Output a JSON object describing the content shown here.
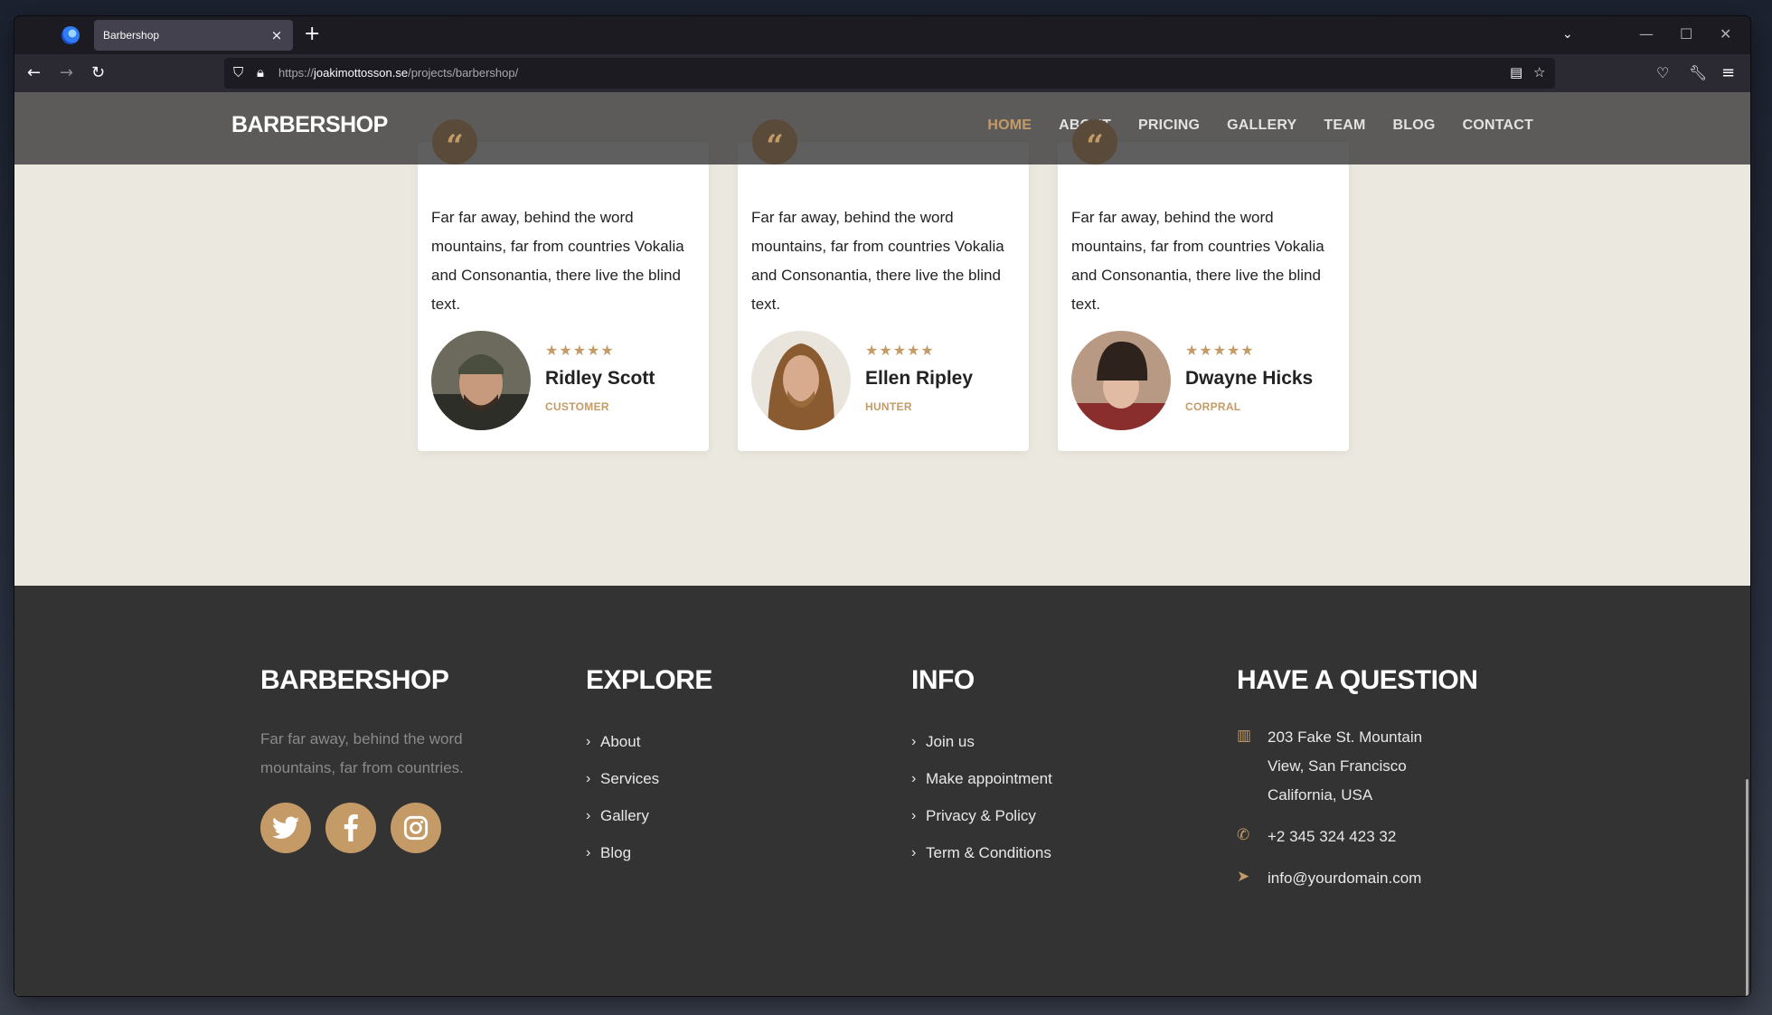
{
  "browser": {
    "tab_title": "Barbershop",
    "tab_close": "×",
    "new_tab": "+",
    "url_prefix": "https://",
    "url_host": "joakimottosson.se",
    "url_path": "/projects/barbershop/"
  },
  "site": {
    "brand": "BARBERSHOP",
    "menu": [
      "HOME",
      "ABOUT",
      "PRICING",
      "GALLERY",
      "TEAM",
      "BLOG",
      "CONTACT"
    ],
    "active_menu": "HOME"
  },
  "testimonials": [
    {
      "quote_mark": "“",
      "text": "Far far away, behind the word mountains, far from countries Vokalia and Consonantia, there live the blind text.",
      "stars": "★★★★★",
      "name": "Ridley Scott",
      "role": "CUSTOMER"
    },
    {
      "quote_mark": "“",
      "text": "Far far away, behind the word mountains, far from countries Vokalia and Consonantia, there live the blind text.",
      "stars": "★★★★★",
      "name": "Ellen Ripley",
      "role": "HUNTER"
    },
    {
      "quote_mark": "“",
      "text": "Far far away, behind the word mountains, far from countries Vokalia and Consonantia, there live the blind text.",
      "stars": "★★★★★",
      "name": "Dwayne Hicks",
      "role": "CORPRAL"
    }
  ],
  "footer": {
    "brand": "BARBERSHOP",
    "description": "Far far away, behind the word mountains, far from countries.",
    "social": [
      "twitter-icon",
      "facebook-icon",
      "instagram-icon"
    ],
    "explore_title": "EXPLORE",
    "explore_links": [
      "About",
      "Services",
      "Gallery",
      "Blog"
    ],
    "info_title": "INFO",
    "info_links": [
      "Join us",
      "Make appointment",
      "Privacy & Policy",
      "Term & Conditions"
    ],
    "question_title": "HAVE A QUESTION",
    "address": "203 Fake St. Mountain View, San Francisco California, USA",
    "phone": "+2 345 324 423 32",
    "email": "info@yourdomain.com"
  },
  "colors": {
    "accent": "#c49b66",
    "footer_bg": "#333333",
    "section_bg": "#ebe8df"
  }
}
